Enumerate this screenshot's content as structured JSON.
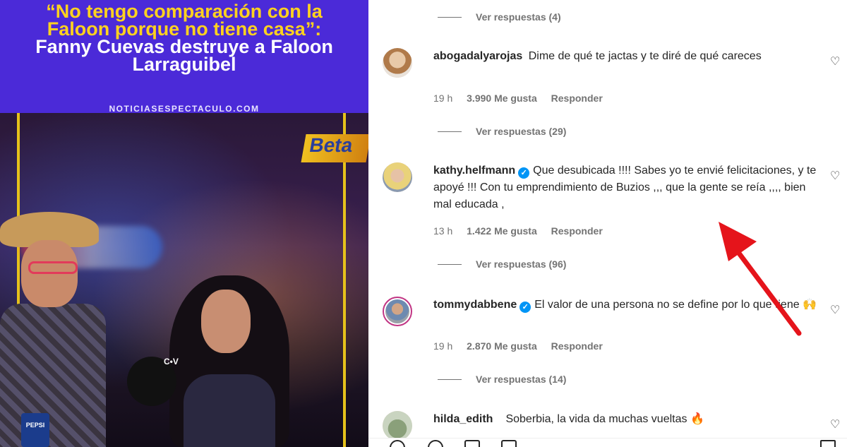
{
  "post": {
    "headline_part1": "“No tengo comparación con la Faloon porque no tiene casa”:",
    "headline_part2": "Fanny Cuevas destruye a Faloon Larraguibel",
    "site": "NOTICIASESPECTACULO.COM",
    "sign_text": "Beta",
    "mic_logo": "C•V",
    "cup_text": "PEPSI"
  },
  "comments": [
    {
      "id": "c0",
      "replies_label": "Ver respuestas (4)"
    },
    {
      "id": "c1",
      "username": "abogadalyarojas",
      "verified": false,
      "text": "Dime de qué te jactas y te diré de qué careces",
      "time": "19 h",
      "likes": "3.990 Me gusta",
      "reply": "Responder",
      "replies_label": "Ver respuestas (29)"
    },
    {
      "id": "c2",
      "username": "kathy.helfmann",
      "verified": true,
      "text": "Que desubicada !!!! Sabes yo te envié felicitaciones, y te apoyé !!! Con tu emprendimiento de Buzios ,,, que la gente se reía ,,,, bien mal educada ,",
      "time": "13 h",
      "likes": "1.422 Me gusta",
      "reply": "Responder",
      "replies_label": "Ver respuestas (96)"
    },
    {
      "id": "c3",
      "username": "tommydabbene",
      "verified": true,
      "text": "El valor de una persona no se define por lo que tiene 🙌",
      "time": "19 h",
      "likes": "2.870 Me gusta",
      "reply": "Responder",
      "replies_label": "Ver respuestas (14)"
    },
    {
      "id": "c4",
      "username": "hilda_edith",
      "verified": false,
      "text": "Soberbia, la vida da muchas vueltas 🔥"
    }
  ],
  "icons": {
    "heart": "heart-icon",
    "verified": "verified-badge-icon",
    "like": "like-icon",
    "comment": "comment-icon",
    "share": "share-icon",
    "save": "save-icon"
  },
  "colors": {
    "banner": "#4b2ad8",
    "headline_yellow": "#ffd21f",
    "verified_blue": "#0095f6",
    "arrow_red": "#e5141b"
  }
}
